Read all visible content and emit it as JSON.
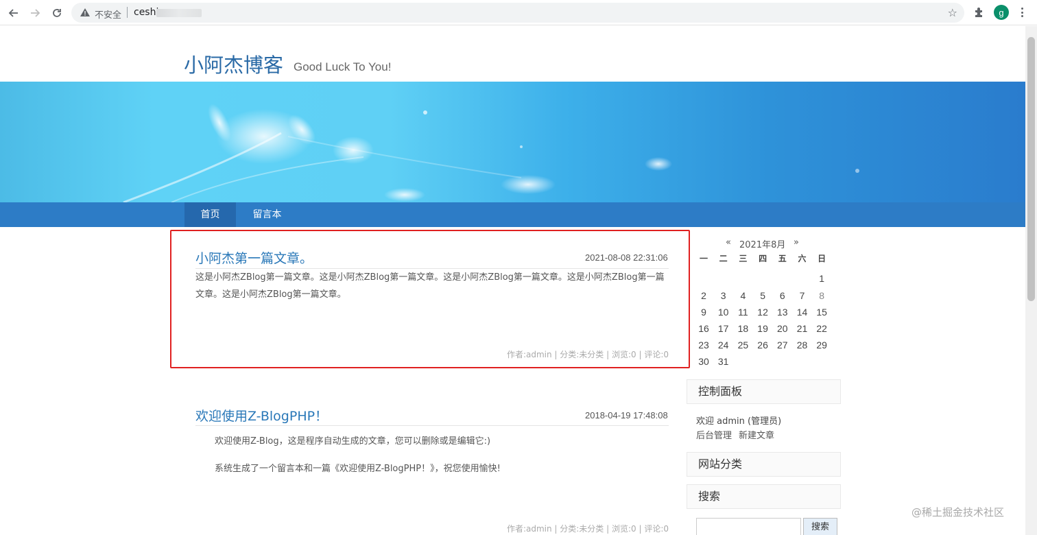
{
  "browser": {
    "insecure_label": "不安全",
    "url_text": "ceshi",
    "profile_initial": "g"
  },
  "site": {
    "title": "小阿杰博客",
    "subtitle": "Good Luck To You!"
  },
  "nav": {
    "items": [
      {
        "label": "首页",
        "active": true
      },
      {
        "label": "留言本",
        "active": false
      }
    ]
  },
  "posts": [
    {
      "title": "小阿杰第一篇文章。",
      "date": "2021-08-08 22:31:06",
      "body": "这是小阿杰ZBlog第一篇文章。这是小阿杰ZBlog第一篇文章。这是小阿杰ZBlog第一篇文章。这是小阿杰ZBlog第一篇文章。这是小阿杰ZBlog第一篇文章。",
      "meta": "作者:admin | 分类:未分类 | 浏览:0 | 评论:0"
    },
    {
      "title": "欢迎使用Z-BlogPHP！",
      "date": "2018-04-19 17:48:08",
      "para1": "欢迎使用Z-Blog，这是程序自动生成的文章，您可以删除或是编辑它:)",
      "para2": "系统生成了一个留言本和一篇《欢迎使用Z-BlogPHP！》，祝您使用愉快!",
      "meta": "作者:admin | 分类:未分类 | 浏览:0 | 评论:0"
    }
  ],
  "calendar": {
    "prev": "«",
    "month": "2021年8月",
    "next": "»",
    "weekdays": [
      "一",
      "二",
      "三",
      "四",
      "五",
      "六",
      "日"
    ],
    "rows": [
      [
        "",
        "",
        "",
        "",
        "",
        "",
        "1"
      ],
      [
        "2",
        "3",
        "4",
        "5",
        "6",
        "7",
        "8"
      ],
      [
        "9",
        "10",
        "11",
        "12",
        "13",
        "14",
        "15"
      ],
      [
        "16",
        "17",
        "18",
        "19",
        "20",
        "21",
        "22"
      ],
      [
        "23",
        "24",
        "25",
        "26",
        "27",
        "28",
        "29"
      ],
      [
        "30",
        "31",
        "",
        "",
        "",
        "",
        ""
      ]
    ]
  },
  "sidebar": {
    "control_panel": "控制面板",
    "welcome": "欢迎 admin (管理员)",
    "admin_link": "后台管理",
    "new_post_link": "新建文章",
    "categories": "网站分类",
    "search_title": "搜索",
    "search_button": "搜索"
  },
  "watermark": "@稀土掘金技术社区",
  "colors": {
    "link": "#2a78b8",
    "nav_bg": "#2d7cc6",
    "nav_active": "#2568ad",
    "highlight": "#e02020"
  }
}
